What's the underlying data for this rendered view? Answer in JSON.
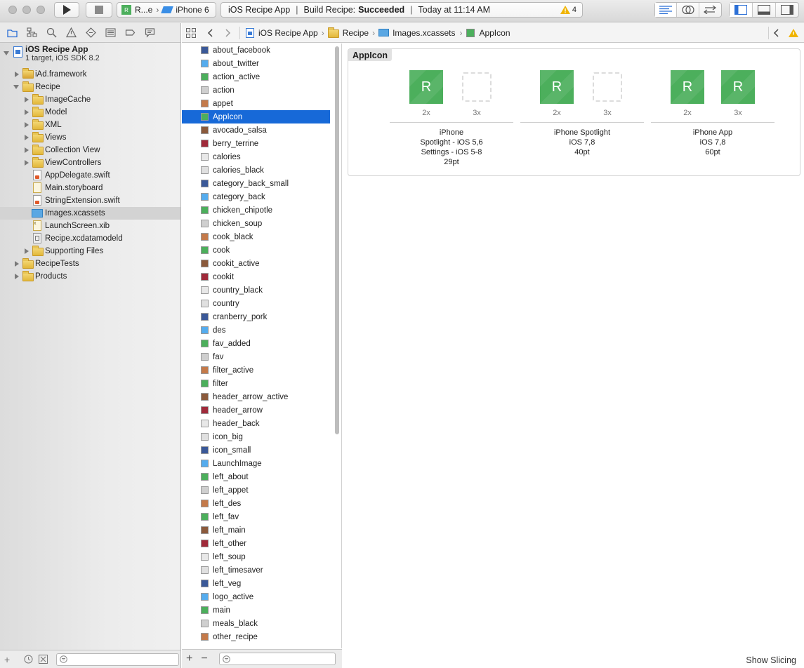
{
  "toolbar": {
    "scheme_name": "R...e",
    "device": "iPhone 6",
    "status_app": "iOS Recipe App",
    "status_build_label": "Build Recipe:",
    "status_build_result": "Succeeded",
    "status_time": "Today at 11:14 AM",
    "warning_count": "4"
  },
  "navigator": {
    "project": {
      "name": "iOS Recipe App",
      "subtitle": "1 target, iOS SDK 8.2"
    },
    "items": [
      {
        "label": "iAd.framework",
        "kind": "framework"
      },
      {
        "label": "Recipe",
        "kind": "folder-open"
      },
      {
        "label": "ImageCache",
        "kind": "folder"
      },
      {
        "label": "Model",
        "kind": "folder"
      },
      {
        "label": "XML",
        "kind": "folder"
      },
      {
        "label": "Views",
        "kind": "folder"
      },
      {
        "label": "Collection View",
        "kind": "folder"
      },
      {
        "label": "ViewControllers",
        "kind": "folder"
      },
      {
        "label": "AppDelegate.swift",
        "kind": "swift"
      },
      {
        "label": "Main.storyboard",
        "kind": "storyboard"
      },
      {
        "label": "StringExtension.swift",
        "kind": "swift"
      },
      {
        "label": "Images.xcassets",
        "kind": "xcassets"
      },
      {
        "label": "LaunchScreen.xib",
        "kind": "xib"
      },
      {
        "label": "Recipe.xcdatamodeld",
        "kind": "datamodel"
      },
      {
        "label": "Supporting Files",
        "kind": "folder"
      },
      {
        "label": "RecipeTests",
        "kind": "folder"
      },
      {
        "label": "Products",
        "kind": "folder"
      }
    ]
  },
  "jumpbar": {
    "crumbs": [
      "iOS Recipe App",
      "Recipe",
      "Images.xcassets",
      "AppIcon"
    ]
  },
  "assets": [
    "about_facebook",
    "about_twitter",
    "action_active",
    "action",
    "appet",
    "AppIcon",
    "avocado_salsa",
    "berry_terrine",
    "calories",
    "calories_black",
    "category_back_small",
    "category_back",
    "chicken_chipotle",
    "chicken_soup",
    "cook_black",
    "cook",
    "cookit_active",
    "cookit",
    "country_black",
    "country",
    "cranberry_pork",
    "des",
    "fav_added",
    "fav",
    "filter_active",
    "filter",
    "header_arrow_active",
    "header_arrow",
    "header_back",
    "icon_big",
    "icon_small",
    "LaunchImage",
    "left_about",
    "left_appet",
    "left_des",
    "left_fav",
    "left_main",
    "left_other",
    "left_soup",
    "left_timesaver",
    "left_veg",
    "logo_active",
    "main",
    "meals_black",
    "other_recipe"
  ],
  "selected_asset": "AppIcon",
  "editor": {
    "set_title": "AppIcon",
    "scale_2x": "2x",
    "scale_3x": "3x",
    "icon_letter": "R",
    "groups": [
      {
        "line1": "iPhone",
        "line2": "Spotlight - iOS 5,6",
        "line3": "Settings - iOS 5-8",
        "line4": "29pt",
        "has3x": false
      },
      {
        "line1": "iPhone Spotlight",
        "line2": "iOS 7,8",
        "line3": "40pt",
        "line4": "",
        "has3x": false
      },
      {
        "line1": "iPhone App",
        "line2": "iOS 7,8",
        "line3": "60pt",
        "line4": "",
        "has3x": true
      }
    ],
    "show_slicing": "Show Slicing"
  },
  "colors": {
    "selection": "#1769d8",
    "icon_green": "#4caf5c",
    "warning": "#f0b400"
  }
}
